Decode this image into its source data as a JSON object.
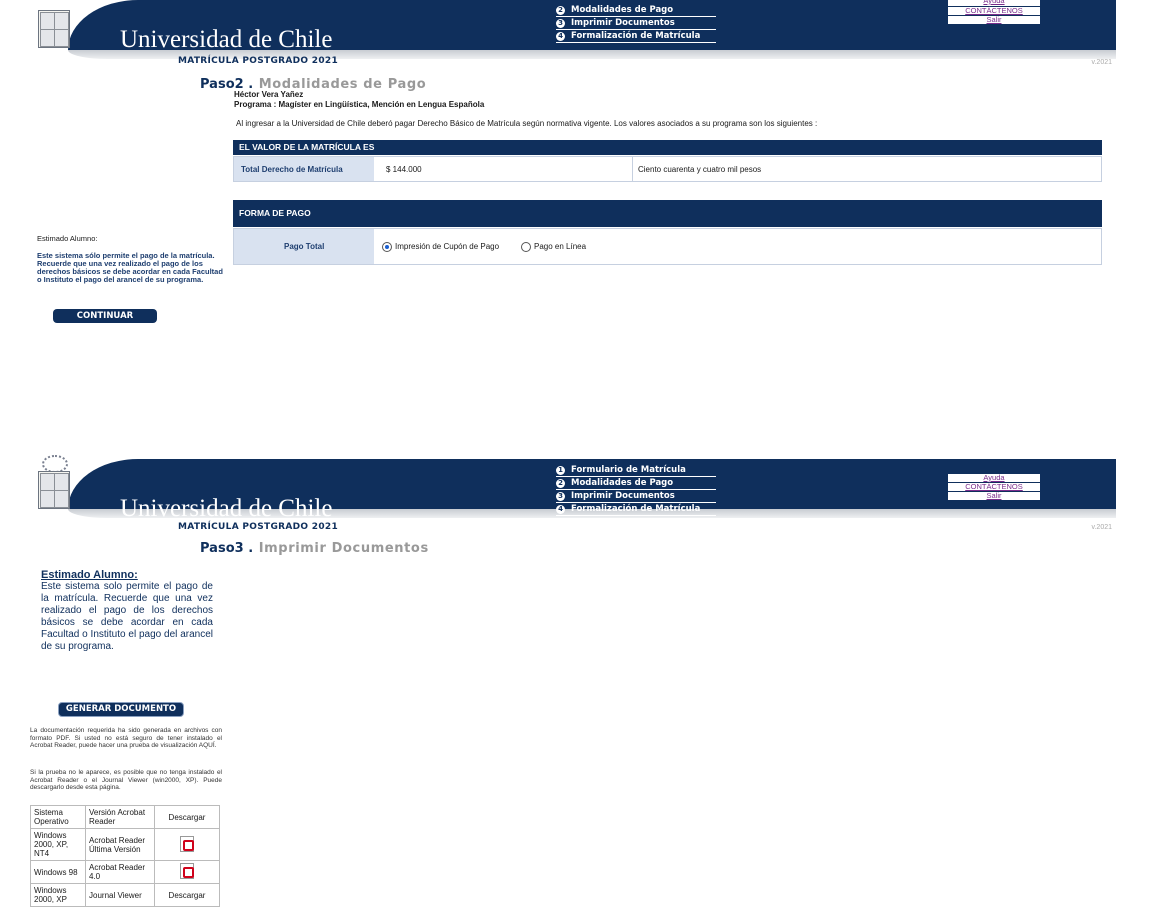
{
  "header": {
    "university": "Universidad de Chile",
    "subtitle": "MATRÍCULA POSTGRADO 2021",
    "version": "v.2021",
    "links": [
      "Ayuda",
      "CONTÁCTENOS",
      "Salir"
    ]
  },
  "screen1": {
    "menu": [
      {
        "num": "2",
        "label": "Modalidades de Pago"
      },
      {
        "num": "3",
        "label": "Imprimir Documentos"
      },
      {
        "num": "4",
        "label": "Formalización de Matrícula"
      }
    ],
    "step_prefix": "Paso2 .",
    "step_title": "Modalidades de Pago",
    "student_name": "Héctor Vera Yañez",
    "program": "Programa : Magíster en Lingüística, Mención en Lengua Española",
    "intro": "Al ingresar a la Universidad de Chile deberó pagar Derecho Básico de Matrícula según normativa vigente. Los valores asociados a su programa son los siguientes :",
    "fee_header": "EL VALOR DE LA MATRÍCULA ES",
    "fee_label": "Total Derecho de Matrícula",
    "fee_amount": "$ 144.000",
    "fee_words": "Ciento cuarenta y cuatro mil pesos",
    "payment_header": "FORMA DE PAGO",
    "payment_label": "Pago Total",
    "payment_options": [
      "Impresión de Cupón de Pago",
      "Pago en Línea"
    ],
    "payment_selected_index": 0,
    "note_title": "Estimado Alumno:",
    "note_text": "Este sistema sólo permite el pago de la matrícula. Recuerde que una vez realizado el pago de los derechos básicos se debe acordar en cada Facultad o Instituto el pago del arancel de su programa.",
    "continue_button": "CONTINUAR"
  },
  "screen2": {
    "menu": [
      {
        "num": "1",
        "label": "Formulario de Matrícula"
      },
      {
        "num": "2",
        "label": "Modalidades de Pago"
      },
      {
        "num": "3",
        "label": "Imprimir Documentos"
      },
      {
        "num": "4",
        "label": "Formalización de Matrícula"
      }
    ],
    "step_prefix": "Paso3 .",
    "step_title": "Imprimir Documentos",
    "note_title": "Estimado Alumno:",
    "note_text": "Este sistema solo permite el pago de la matrícula. Recuerde que una vez realizado el pago de los derechos básicos se debe acordar en cada Facultad o Instituto el pago del arancel de su programa.",
    "generate_button": "GENERAR DOCUMENTO",
    "info1": "La documentación requerida ha sido generada en archivos con formato PDF. Si usted no está seguro de tener instalado el Acrobat Reader, puede hacer una prueba de visualización AQUÍ.",
    "info2": "Si la prueba no le aparece, es posible que no tenga instalado el Acrobat Reader o el Journal Viewer (win2000, XP). Puede descargarlo desde esta página.",
    "table_headers": [
      "Sistema Operativo",
      "Versión Acrobat Reader",
      "Descargar"
    ],
    "table_rows": [
      {
        "os": "Windows 2000, XP, NT4",
        "version": "Acrobat Reader Última Versión",
        "download": "pdf-icon"
      },
      {
        "os": "Windows 98",
        "version": "Acrobat Reader 4.0",
        "download": "pdf-icon"
      },
      {
        "os": "Windows 2000, XP",
        "version": "Journal Viewer",
        "download": "Descargar"
      }
    ]
  }
}
